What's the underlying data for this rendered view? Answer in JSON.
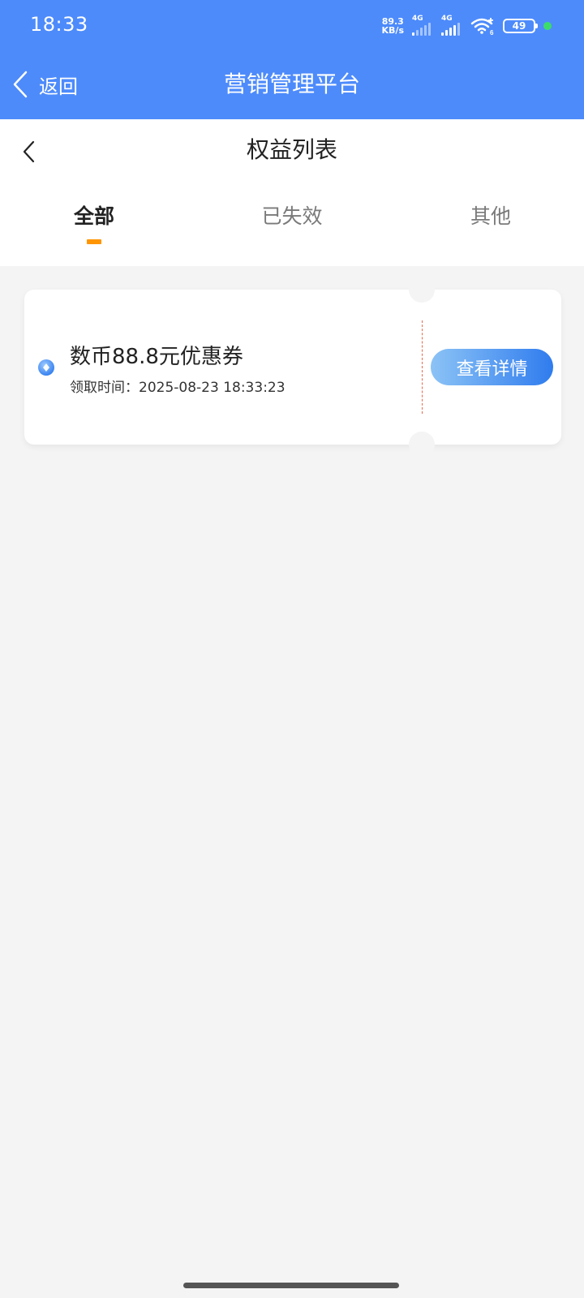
{
  "status_bar": {
    "time": "18:33",
    "net_speed_value": "89.3",
    "net_speed_unit": "KB/s",
    "sim1_type": "4G",
    "sim2_type": "4G",
    "wifi_badge": "6",
    "battery": "49"
  },
  "app_bar": {
    "back_label": "返回",
    "title": "营销管理平台"
  },
  "page": {
    "title": "权益列表"
  },
  "tabs": [
    {
      "label": "全部",
      "active": true
    },
    {
      "label": "已失效",
      "active": false
    },
    {
      "label": "其他",
      "active": false
    }
  ],
  "coupons": [
    {
      "name": "数币88.8元优惠券",
      "received_time": "领取时间：2025-08-23 18:33:23",
      "action_label": "查看详情"
    }
  ],
  "colors": {
    "primary_blue": "#4d8bfb",
    "tab_indicator": "#ff9500",
    "divider": "#e66a4a",
    "background": "#f4f4f4"
  }
}
